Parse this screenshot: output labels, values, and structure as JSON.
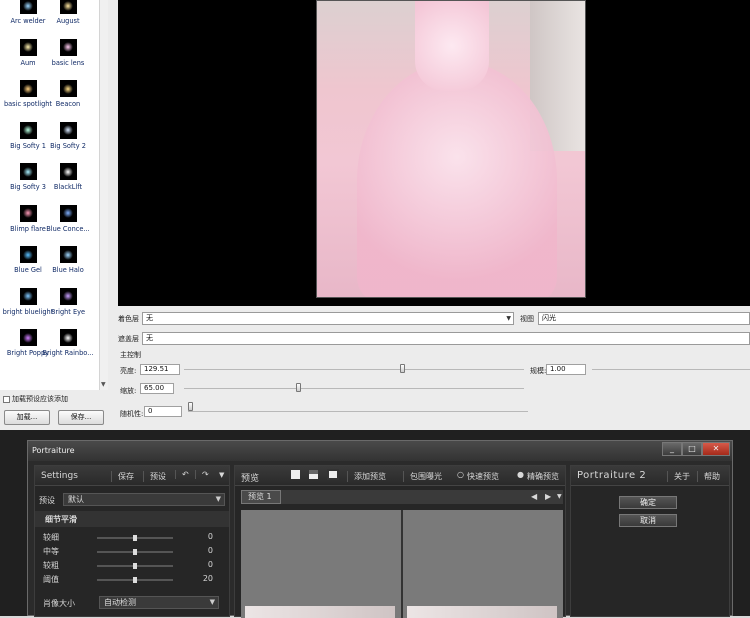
{
  "lights": [
    {
      "label": "Arc welder",
      "color": "#9bd6ff"
    },
    {
      "label": "August",
      "color": "#ffe6a0"
    },
    {
      "label": "Aum",
      "color": "#fff0b0"
    },
    {
      "label": "basic lens",
      "color": "#ffcaf0"
    },
    {
      "label": "basic spotlight",
      "color": "#ffd080"
    },
    {
      "label": "Beacon",
      "color": "#ffdd88"
    },
    {
      "label": "Big Softy 1",
      "color": "#b8ffe0"
    },
    {
      "label": "Big Softy 2",
      "color": "#d8e8ff"
    },
    {
      "label": "Big Softy 3",
      "color": "#a8f0ff"
    },
    {
      "label": "BlackLlft",
      "color": "#ffffff"
    },
    {
      "label": "Blimp flare",
      "color": "#ff9ab8"
    },
    {
      "label": "Blue Conce...",
      "color": "#80b0ff"
    },
    {
      "label": "Blue Gel",
      "color": "#5ac0ff"
    },
    {
      "label": "Blue Halo",
      "color": "#a0d8ff"
    },
    {
      "label": "bright bluelight",
      "color": "#80c8ff"
    },
    {
      "label": "Bright Eye",
      "color": "#c8a0ff"
    },
    {
      "label": "Bright Poppy",
      "color": "#d080ff"
    },
    {
      "label": "Bright Rainbo...",
      "color": "#ffffff"
    }
  ],
  "light_panel": {
    "add_preset_label": "加载预设应该添加",
    "load_button": "加载...",
    "save_button": "保存..."
  },
  "controls": {
    "color_layer_label": "着色层",
    "color_layer_value": "无",
    "view_label": "视图",
    "view_value": "闪光",
    "mask_label": "遮盖层",
    "mask_value": "无",
    "main_control_label": "主控制",
    "brightness_label": "亮度:",
    "brightness_value": "129.51",
    "gain_label": "规模:",
    "gain_value": "1.00",
    "scale_label": "缩放:",
    "scale_value": "65.00",
    "random_label": "随机性:",
    "random_value": "0"
  },
  "portraiture": {
    "window_title": "Portraiture",
    "settings_label": "Settings",
    "save_btn": "保存",
    "preset_btn": "预设",
    "undo_icon": "undo-icon",
    "redo_icon": "redo-icon",
    "preset_label": "预设",
    "preset_value": "默认",
    "detail_smooth": "细节平滑",
    "sliders": [
      {
        "label": "较细",
        "value": "0"
      },
      {
        "label": "中等",
        "value": "0"
      },
      {
        "label": "较粗",
        "value": "0"
      },
      {
        "label": "阈值",
        "value": "20"
      }
    ],
    "portrait_size_label": "肖像大小",
    "portrait_size_value": "自动检测",
    "preview_label": "预览",
    "add_preview": "添加预览",
    "surround_exposure": "包围曝光",
    "fast_preview": "快速预览",
    "accurate_preview": "精确预览",
    "preview_tab": "预览 1",
    "brand_prefix": "Portraiture",
    "brand_version": "2",
    "about": "关于",
    "help": "帮助",
    "ok": "确定",
    "cancel": "取消"
  }
}
